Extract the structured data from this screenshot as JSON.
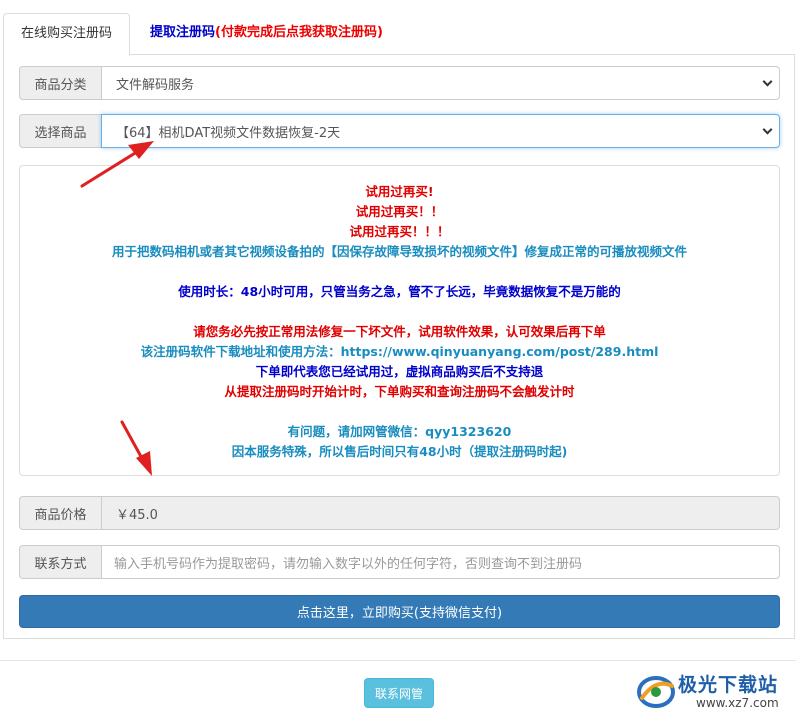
{
  "tabs": [
    {
      "label": "在线购买注册码",
      "active": true
    },
    {
      "label_main": "提取注册码",
      "label_note": "(付款完成后点我获取注册码)",
      "active": false
    }
  ],
  "category": {
    "label": "商品分类",
    "value": "文件解码服务"
  },
  "product": {
    "label": "选择商品",
    "value": "【64】相机DAT视频文件数据恢复-2天"
  },
  "description": {
    "lines": [
      "试用过再买!",
      "试用过再买！！",
      "试用过再买！！！",
      "用于把数码相机或者其它视频设备拍的【因保存故障导致损坏的视频文件】修复成正常的可播放视频文件",
      "使用时长：48小时可用，只管当务之急，管不了长远，毕竟数据恢复不是万能的",
      "请您务必先按正常用法修复一下坏文件，试用软件效果，认可效果后再下单",
      "该注册码软件下载地址和使用方法：https://www.qinyuanyang.com/post/289.html",
      "下单即代表您已经试用过，虚拟商品购买后不支持退",
      "从提取注册码时开始计时，下单购买和查询注册码不会触发计时",
      "有问题，请加网管微信：qyy1323620",
      "因本服务特殊，所以售后时间只有48小时（提取注册码时起)"
    ]
  },
  "price": {
    "label": "商品价格",
    "value": "￥45.0"
  },
  "contact": {
    "label": "联系方式",
    "placeholder": "输入手机号码作为提取密码，请勿输入数字以外的任何字符，否则查询不到注册码"
  },
  "buy_button": "点击这里，立即购买(支持微信支付)",
  "contact_admin_button": "联系网管",
  "watermark": {
    "title": "极光下载站",
    "url": "www.xz7.com"
  },
  "colors": {
    "primary": "#337ab7",
    "info": "#5bc0de",
    "red": "#e00000",
    "teal": "#1a8dbf",
    "blue": "#0000cc",
    "arrow": "#e02020"
  }
}
